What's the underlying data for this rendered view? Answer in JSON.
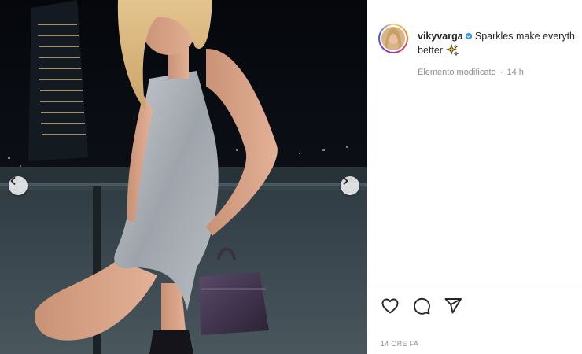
{
  "post": {
    "username": "vikyvarga",
    "caption_line1": "Sparkles make everyth",
    "caption_line2": "better",
    "sparkle_emoji_icon": "sparkles-icon",
    "edited_label": "Elemento modificato",
    "separator": "·",
    "relative_time": "14 h",
    "timestamp": "14 ORE FA"
  },
  "media": {
    "prev_icon": "chevron-left-icon",
    "next_icon": "chevron-right-icon"
  },
  "actions": {
    "like_icon": "heart-icon",
    "comment_icon": "comment-icon",
    "share_icon": "paper-plane-icon"
  },
  "colors": {
    "verified_blue": "#3897f0",
    "text_primary": "#262626",
    "text_secondary": "#8e8e8e"
  }
}
